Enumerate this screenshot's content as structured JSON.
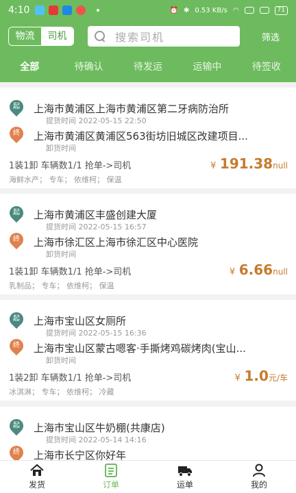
{
  "status_bar": {
    "time": "4:10",
    "network": "0.53 KB/s",
    "battery": "71"
  },
  "header": {
    "toggle": {
      "option_1": "物流",
      "option_2": "司机",
      "selected": "司机"
    },
    "search": {
      "placeholder": "搜索司机"
    },
    "filter_label": "筛选"
  },
  "tabs": [
    {
      "label": "全部",
      "active": true
    },
    {
      "label": "待确认"
    },
    {
      "label": "待发运"
    },
    {
      "label": "运输中"
    },
    {
      "label": "待签收"
    }
  ],
  "badge_labels": {
    "start": "起",
    "end": "终"
  },
  "orders": [
    {
      "from": "上海市黄浦区上海市黄浦区第二牙病防治所",
      "from_time": "提货时间 2022-05-15 22:50",
      "to": "上海市黄浦区黄浦区563街坊旧城区改建项目...",
      "to_time": "卸货时间",
      "info": "1装1卸   车辆数1/1   抢单->司机",
      "tags": "海鲜水产；   专车；   依维柯；   保温",
      "price_symbol": "¥",
      "price": "191.38",
      "price_unit": "null"
    },
    {
      "from": "上海市黄浦区丰盛创建大厦",
      "from_time": "提货时间 2022-05-15 16:57",
      "to": "上海市徐汇区上海市徐汇区中心医院",
      "to_time": "卸货时间",
      "info": "1装1卸   车辆数1/1   抢单->司机",
      "tags": "乳制品；   专车；   依维柯；   保温",
      "price_symbol": "¥",
      "price": "6.66",
      "price_unit": "null"
    },
    {
      "from": "上海市宝山区女厕所",
      "from_time": "提货时间 2022-05-15 16:36",
      "to": "上海市宝山区蒙古嗯客·手撕烤鸡碳烤肉(宝山...",
      "to_time": "卸货时间",
      "info": "1装2卸   车辆数1/1   抢单->司机",
      "tags": "冰淇淋；   专车；   依维柯；   冷藏",
      "price_symbol": "¥",
      "price": "1.0",
      "price_unit": "元/车"
    },
    {
      "from": "上海市宝山区牛奶棚(共康店)",
      "from_time": "提货时间 2022-05-14 14:16",
      "to": "上海市长宁区你好年",
      "to_time": "",
      "info": "",
      "tags": "",
      "price_symbol": "",
      "price": "",
      "price_unit": ""
    }
  ],
  "bottom_nav": [
    {
      "label": "发货",
      "icon": "home-icon"
    },
    {
      "label": "订单",
      "icon": "order-list-icon",
      "active": true
    },
    {
      "label": "运单",
      "icon": "truck-icon"
    },
    {
      "label": "我的",
      "icon": "profile-icon"
    }
  ],
  "colors": {
    "primary": "#6dbb5e",
    "price": "#c77a2e",
    "start_badge": "#4b8a80",
    "end_badge": "#e0824d"
  }
}
